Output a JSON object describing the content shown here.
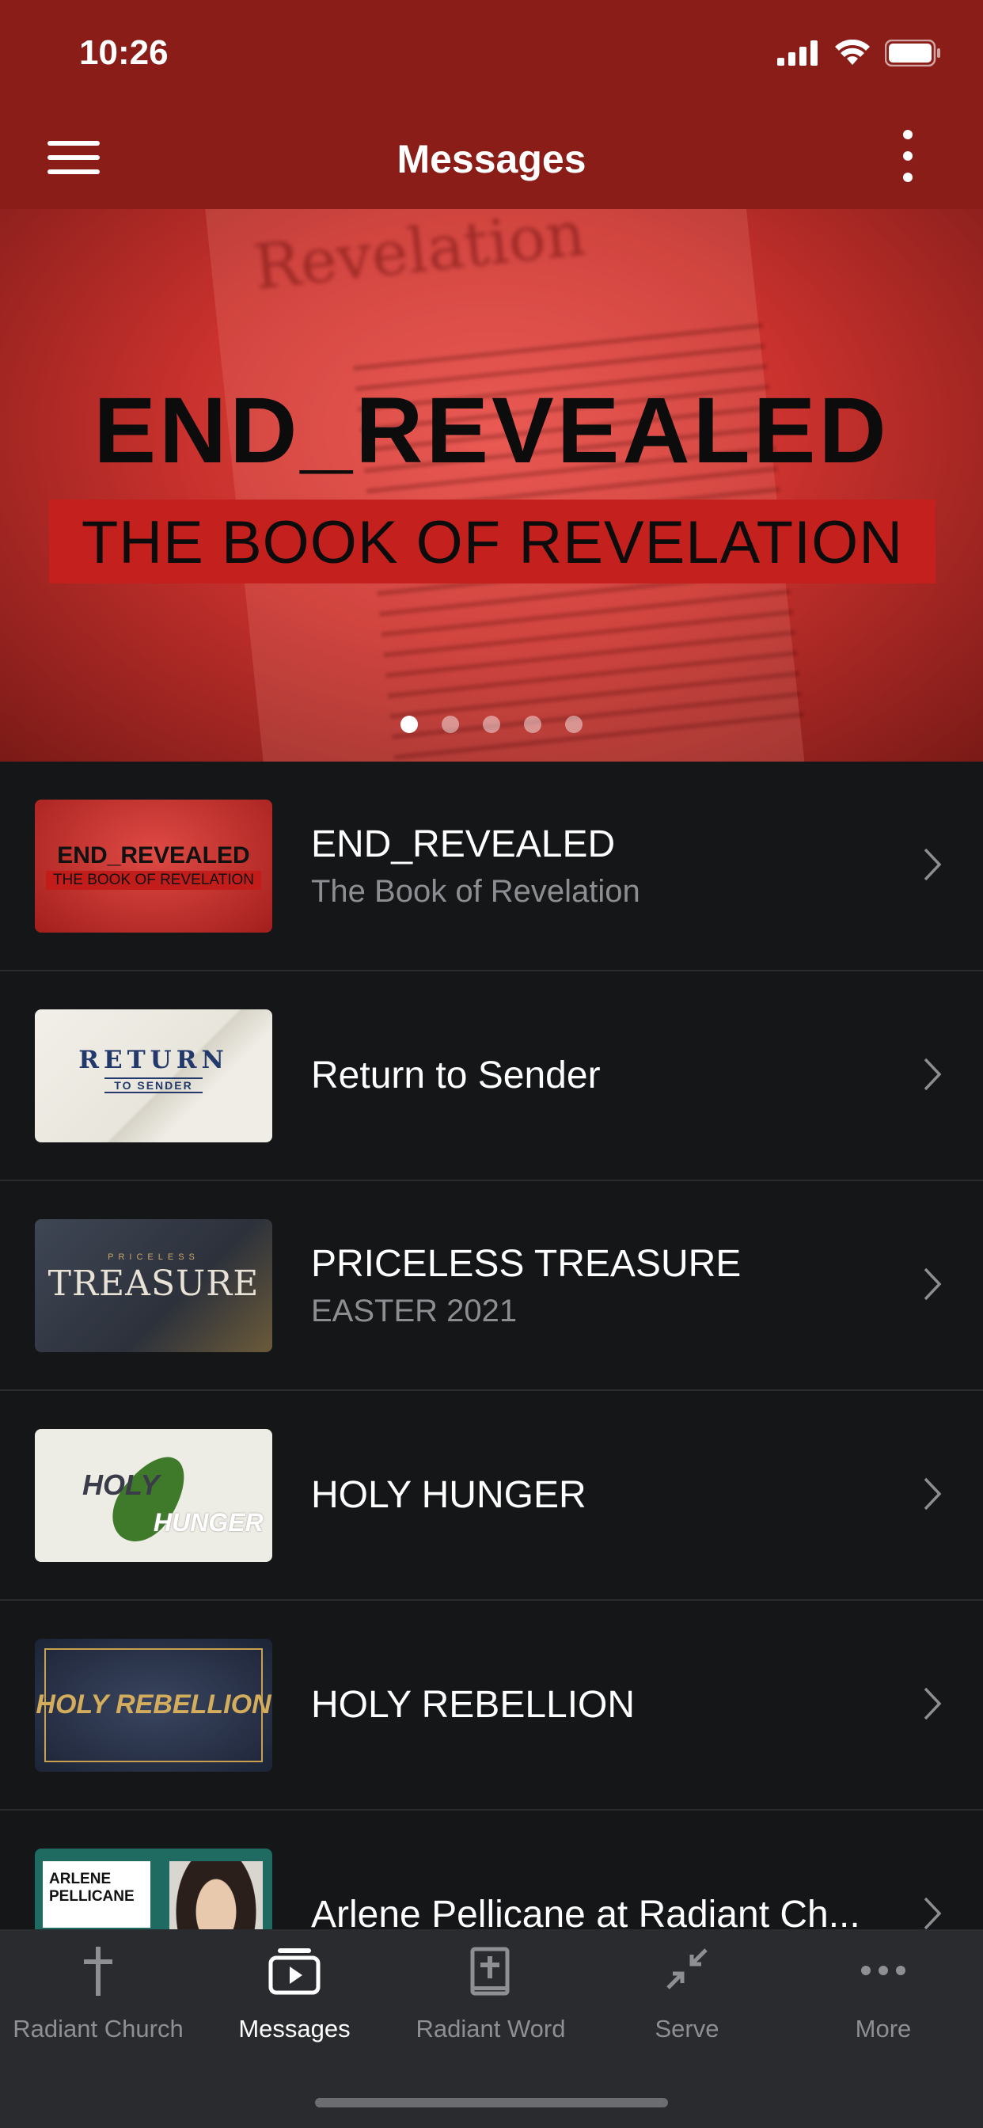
{
  "status_bar": {
    "time": "10:26"
  },
  "header": {
    "title": "Messages"
  },
  "hero": {
    "background_word": "Revelation",
    "title": "END_REVEALED",
    "subtitle": "THE BOOK OF REVELATION",
    "pager": {
      "count": 5,
      "active_index": 0
    }
  },
  "series": [
    {
      "title": "END_REVEALED",
      "subtitle": "The Book of Revelation",
      "thumb_lines": [
        "END_REVEALED",
        "THE BOOK OF REVELATION"
      ]
    },
    {
      "title": "Return to Sender",
      "subtitle": "",
      "thumb_lines": [
        "RETURN",
        "TO SENDER"
      ]
    },
    {
      "title": "PRICELESS TREASURE",
      "subtitle": "EASTER 2021",
      "thumb_lines": [
        "TREASURE",
        "PRICELESS"
      ]
    },
    {
      "title": "HOLY HUNGER",
      "subtitle": "",
      "thumb_lines": [
        "HOLY",
        "HUNGER"
      ]
    },
    {
      "title": "HOLY REBELLION",
      "subtitle": "",
      "thumb_lines": [
        "HOLY REBELLION"
      ]
    },
    {
      "title": "Arlene Pellicane at Radiant Ch...",
      "subtitle": "",
      "thumb_lines": [
        "ARLENE PELLICANE"
      ]
    }
  ],
  "tabs": [
    {
      "label": "Radiant Church",
      "icon": "cross-icon"
    },
    {
      "label": "Messages",
      "icon": "media-player-icon"
    },
    {
      "label": "Radiant Word",
      "icon": "bible-icon"
    },
    {
      "label": "Serve",
      "icon": "collapse-arrows-icon"
    },
    {
      "label": "More",
      "icon": "ellipsis-icon"
    }
  ],
  "active_tab": "Messages",
  "colors": {
    "header_bg": "#8a1d18",
    "list_bg": "#151618",
    "tabbar_bg": "#2a2b2e"
  }
}
